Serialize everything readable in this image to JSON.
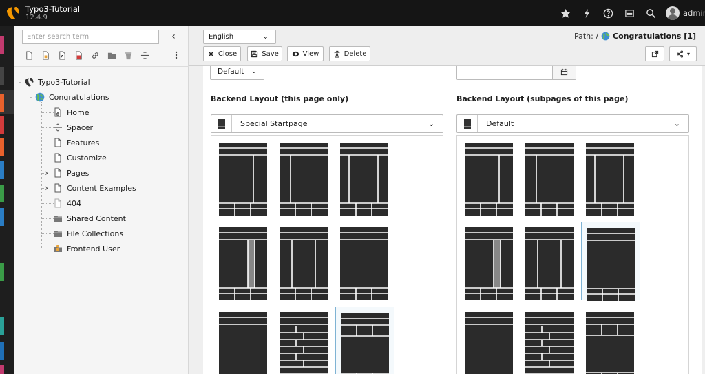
{
  "topbar": {
    "app_title": "Typo3-Tutorial",
    "app_version": "12.4.9",
    "icons": [
      "star-icon",
      "bolt-icon",
      "help-icon",
      "list-icon",
      "search-icon"
    ],
    "user_name": "admin"
  },
  "rail": {
    "colors": [
      "#c23a6e",
      "#444444",
      "#e8612c",
      "#d23b3b",
      "#e8612c",
      "#2a7dc4",
      "#3a9b47",
      "#2a7dc4",
      "#3a9b47",
      "#2aa198",
      "#1f6fb6",
      "#c23a6e"
    ]
  },
  "tree_panel": {
    "search_placeholder": "Enter search term",
    "collapse_icon": "chevron-left-icon",
    "tools": [
      "new-page-icon",
      "new-shortcut-icon",
      "new-link-icon",
      "new-mount-icon",
      "link-icon",
      "folder-icon",
      "recycler-icon",
      "spacer-icon"
    ],
    "more_icon": "ellipsis-vertical-icon",
    "root": "Typo3-Tutorial",
    "site": "Congratulations",
    "pages": [
      {
        "label": "Home",
        "icon": "page-home-icon",
        "expandable": false
      },
      {
        "label": "Spacer",
        "icon": "spacer-icon",
        "expandable": false
      },
      {
        "label": "Features",
        "icon": "page-icon",
        "expandable": false
      },
      {
        "label": "Customize",
        "icon": "page-icon",
        "expandable": false
      },
      {
        "label": "Pages",
        "icon": "page-icon",
        "expandable": true
      },
      {
        "label": "Content Examples",
        "icon": "page-icon",
        "expandable": true
      },
      {
        "label": "404",
        "icon": "page-hidden-icon",
        "expandable": false
      },
      {
        "label": "Shared Content",
        "icon": "folder-icon",
        "expandable": false
      },
      {
        "label": "File Collections",
        "icon": "folder-icon",
        "expandable": false
      },
      {
        "label": "Frontend User",
        "icon": "folder-user-icon",
        "expandable": false
      }
    ]
  },
  "docheader": {
    "language": "English",
    "path_label": "Path: /",
    "path_page": "Congratulations [1]",
    "buttons": {
      "close": "Close",
      "save": "Save",
      "view": "View",
      "delete": "Delete"
    }
  },
  "form": {
    "top_select_value": "Default",
    "backend_layout_this": {
      "label": "Backend Layout (this page only)",
      "value": "Special Startpage",
      "selected_index": 8
    },
    "backend_layout_sub": {
      "label": "Backend Layout (subpages of this page)",
      "value": "Default",
      "selected_index": 5
    },
    "layout_variants": [
      "3col",
      "2col-left",
      "2col-right",
      "3col-border",
      "2col-equal",
      "1col",
      "1col-tall",
      "rows",
      "grid-header"
    ]
  }
}
